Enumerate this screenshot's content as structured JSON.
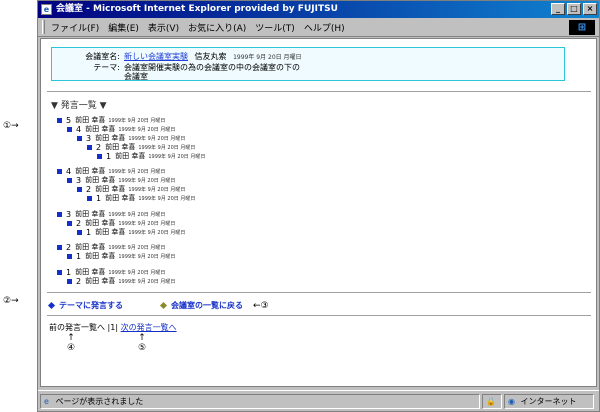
{
  "annotations": {
    "a1": "①→",
    "a2": "②→",
    "a3": "←③",
    "a4": "↑",
    "a4n": "④",
    "a5": "↑",
    "a5n": "⑤"
  },
  "window": {
    "title": "会議室 - Microsoft Internet Explorer provided by FUJITSU",
    "buttons": [
      "_",
      "□",
      "×"
    ]
  },
  "menu": [
    "ファイル(F)",
    "編集(E)",
    "表示(V)",
    "お気に入り(A)",
    "ツール(T)",
    "ヘルプ(H)"
  ],
  "room": {
    "name_label": "会議室名:",
    "name": "新しい会議室実験",
    "owner": "信友丸索",
    "name_date": "1999年 9月 20日 月曜日",
    "theme_label": "テーマ:",
    "theme_line1": "会議室開催実験の為の会議室の中の会議室の下の",
    "theme_line2": "会議室"
  },
  "list_heading": "▼ 発言一覧 ▼",
  "posts": [
    {
      "num": "5",
      "author": "前田 幸喜",
      "date": "1999年 9月 20日 月曜日"
    },
    {
      "num": "4",
      "author": "前田 幸喜",
      "date": "1999年 9月 20日 月曜日"
    },
    {
      "num": "3",
      "author": "前田 幸喜",
      "date": "1999年 9月 20日 月曜日"
    },
    {
      "num": "2",
      "author": "前田 幸喜",
      "date": "1999年 9月 20日 月曜日"
    },
    {
      "num": "1",
      "author": "前田 幸喜",
      "date": "1999年 9月 20日 月曜日"
    },
    {
      "num": "4",
      "author": "前田 幸喜",
      "date": "1999年 9月 20日 月曜日"
    },
    {
      "num": "3",
      "author": "前田 幸喜",
      "date": "1999年 9月 20日 月曜日"
    },
    {
      "num": "2",
      "author": "前田 幸喜",
      "date": "1999年 9月 20日 月曜日"
    },
    {
      "num": "1",
      "author": "前田 幸喜",
      "date": "1999年 9月 20日 月曜日"
    },
    {
      "num": "3",
      "author": "前田 幸喜",
      "date": "1999年 9月 20日 月曜日"
    },
    {
      "num": "2",
      "author": "前田 幸喜",
      "date": "1999年 9月 20日 月曜日"
    },
    {
      "num": "1",
      "author": "前田 幸喜",
      "date": "1999年 9月 20日 月曜日"
    },
    {
      "num": "2",
      "author": "前田 幸喜",
      "date": "1999年 9月 20日 月曜日"
    },
    {
      "num": "1",
      "author": "前田 幸喜",
      "date": "1999年 9月 20日 月曜日"
    },
    {
      "num": "1",
      "author": "前田 幸喜",
      "date": "1999年 9月 20日 月曜日"
    },
    {
      "num": "2",
      "author": "前田 幸喜",
      "date": "1999年 9月 20日 月曜日"
    }
  ],
  "links": {
    "post_to_theme": "テーマに発言する",
    "back_to_rooms": "会議室の一覧に戻る",
    "prev": "前の発言一覧へ",
    "sep": "|1|",
    "next": "次の発言一覧へ"
  },
  "status": {
    "text": "ページが表示されました",
    "zone": "インターネット"
  },
  "colors": {
    "link": "#1530c8",
    "square": "#1530c8",
    "diamond_post": "#1530c8",
    "diamond_back": "#8a8a30",
    "info_border": "#2cc6d6"
  }
}
